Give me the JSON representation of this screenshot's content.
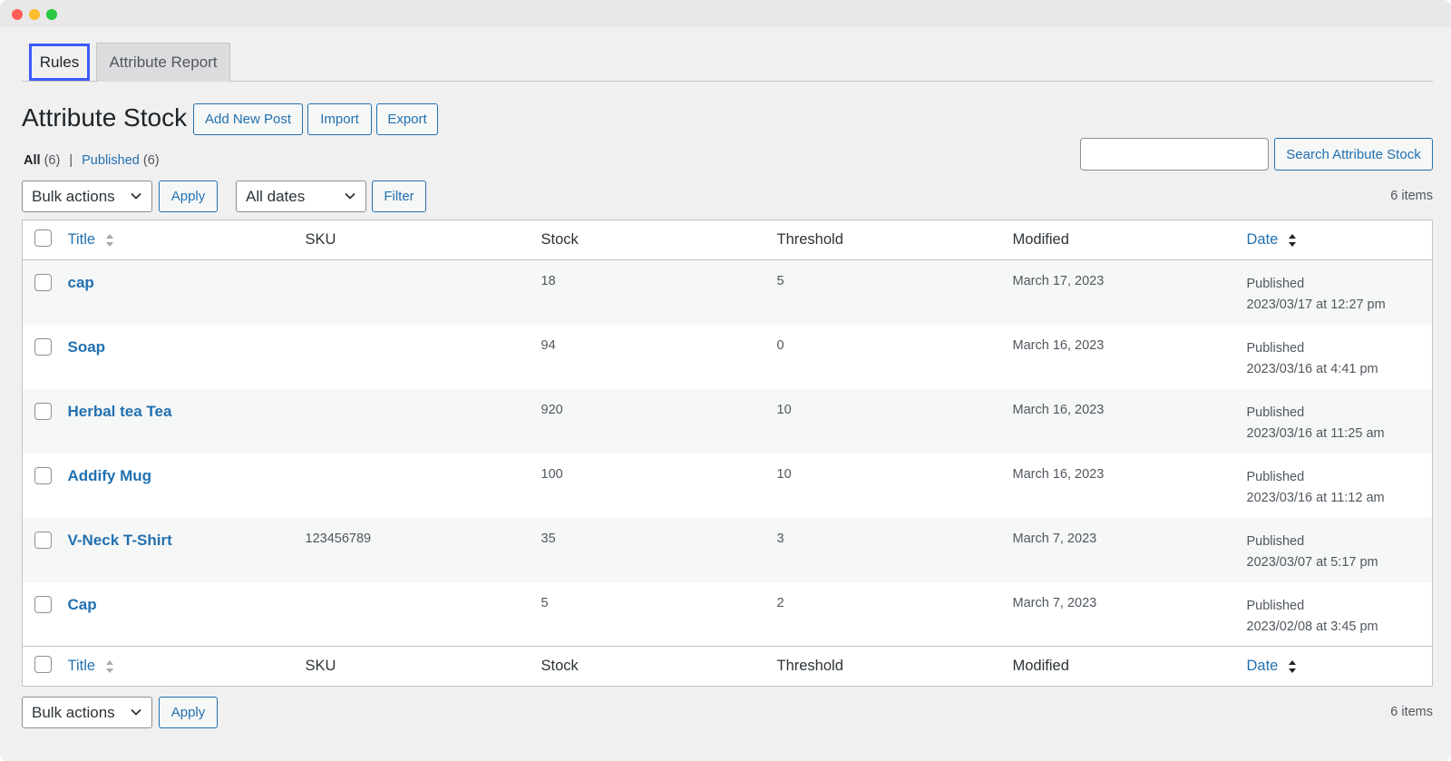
{
  "tabs": [
    {
      "label": "Rules",
      "active": true
    },
    {
      "label": "Attribute Report",
      "active": false
    }
  ],
  "page": {
    "title": "Attribute Stock",
    "buttons": {
      "add_new": "Add New Post",
      "import": "Import",
      "export": "Export"
    }
  },
  "views": {
    "all_label": "All",
    "all_count": "(6)",
    "separator": "|",
    "published_label": "Published",
    "published_count": "(6)"
  },
  "search": {
    "placeholder": "",
    "button": "Search Attribute Stock"
  },
  "top_nav": {
    "bulk_actions": "Bulk actions",
    "apply": "Apply",
    "dates": "All dates",
    "filter": "Filter",
    "items_count": "6 items"
  },
  "bottom_nav": {
    "bulk_actions": "Bulk actions",
    "apply": "Apply",
    "items_count": "6 items"
  },
  "columns": {
    "title": "Title",
    "sku": "SKU",
    "stock": "Stock",
    "threshold": "Threshold",
    "modified": "Modified",
    "date": "Date"
  },
  "rows": [
    {
      "title": "cap",
      "sku": "",
      "stock": "18",
      "threshold": "5",
      "modified": "March 17, 2023",
      "status": "Published",
      "date": "2023/03/17 at 12:27 pm"
    },
    {
      "title": "Soap",
      "sku": "",
      "stock": "94",
      "threshold": "0",
      "modified": "March 16, 2023",
      "status": "Published",
      "date": "2023/03/16 at 4:41 pm"
    },
    {
      "title": "Herbal tea Tea",
      "sku": "",
      "stock": "920",
      "threshold": "10",
      "modified": "March 16, 2023",
      "status": "Published",
      "date": "2023/03/16 at 11:25 am"
    },
    {
      "title": "Addify Mug",
      "sku": "",
      "stock": "100",
      "threshold": "10",
      "modified": "March 16, 2023",
      "status": "Published",
      "date": "2023/03/16 at 11:12 am"
    },
    {
      "title": "V-Neck T-Shirt",
      "sku": "123456789",
      "stock": "35",
      "threshold": "3",
      "modified": "March 7, 2023",
      "status": "Published",
      "date": "2023/03/07 at 5:17 pm"
    },
    {
      "title": "Cap",
      "sku": "",
      "stock": "5",
      "threshold": "2",
      "modified": "March 7, 2023",
      "status": "Published",
      "date": "2023/02/08 at 3:45 pm"
    }
  ],
  "colors": {
    "link": "#2271b1",
    "highlight_border": "#3b5bfd",
    "background": "#f0f0f1"
  }
}
